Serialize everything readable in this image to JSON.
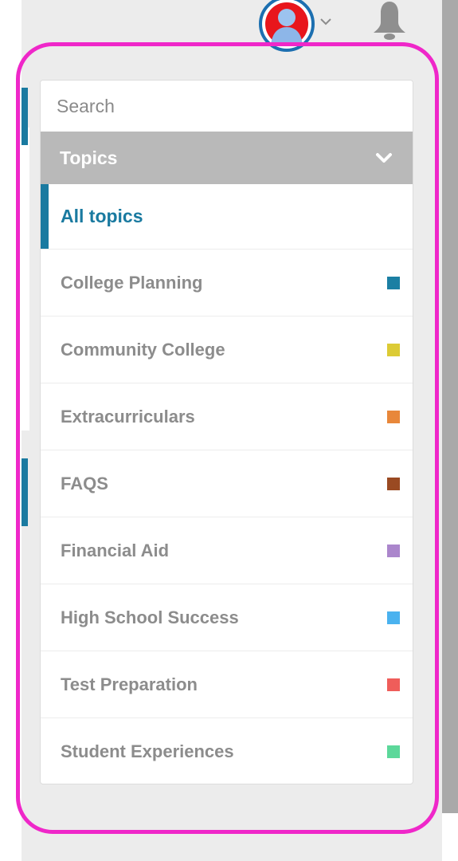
{
  "header": {
    "avatar_icon": "user-avatar-icon",
    "avatar_dropdown_icon": "chevron-down-icon",
    "notifications_icon": "bell-icon"
  },
  "sidebar": {
    "search": {
      "placeholder": "Search",
      "value": ""
    },
    "topics_header": {
      "label": "Topics",
      "icon": "chevron-down-icon",
      "expanded": true
    },
    "items": [
      {
        "label": "All topics",
        "active": true,
        "color": ""
      },
      {
        "label": "College Planning",
        "active": false,
        "color": "#1b7fa3"
      },
      {
        "label": "Community College",
        "active": false,
        "color": "#dccb35"
      },
      {
        "label": "Extracurriculars",
        "active": false,
        "color": "#e8873a"
      },
      {
        "label": "FAQS",
        "active": false,
        "color": "#9a4a22"
      },
      {
        "label": "Financial Aid",
        "active": false,
        "color": "#ab86cc"
      },
      {
        "label": "High School Success",
        "active": false,
        "color": "#4ab2ef"
      },
      {
        "label": "Test Preparation",
        "active": false,
        "color": "#ef5d5a"
      },
      {
        "label": "Student Experiences",
        "active": false,
        "color": "#5cd89a"
      }
    ]
  },
  "colors": {
    "accent": "#1a7aa0",
    "header_bg": "#b9b9b9",
    "highlight_outline": "#ef27c9",
    "muted_text": "#8c8c8c"
  }
}
